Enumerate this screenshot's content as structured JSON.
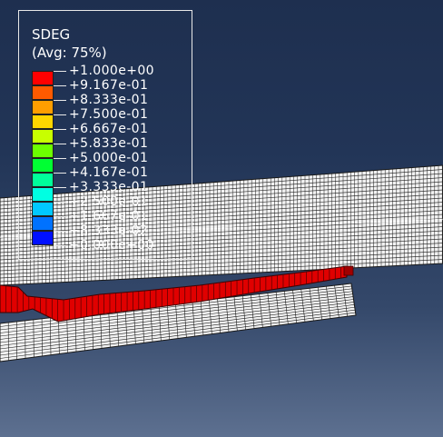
{
  "legend": {
    "title": "SDEG",
    "subtitle": "(Avg: 75%)",
    "values": [
      "+1.000e+00",
      "+9.167e-01",
      "+8.333e-01",
      "+7.500e-01",
      "+6.667e-01",
      "+5.833e-01",
      "+5.000e-01",
      "+4.167e-01",
      "+3.333e-01",
      "+2.500e-01",
      "+1.667e-01",
      "+8.333e-02",
      "+0.000e+00"
    ],
    "bands": [
      "#ff0000",
      "#ff5a00",
      "#ff9e00",
      "#ffd600",
      "#c8ff00",
      "#6cff00",
      "#00ff33",
      "#00ff9a",
      "#00ffe2",
      "#00c8ff",
      "#0072ff",
      "#0010ff"
    ]
  },
  "colors": {
    "background_top": "#1e2f4f",
    "background_bottom": "#5d7090",
    "mesh_fill": "#f2f2f2",
    "mesh_lines": "#1a1a1a",
    "damaged": "#e00000"
  }
}
